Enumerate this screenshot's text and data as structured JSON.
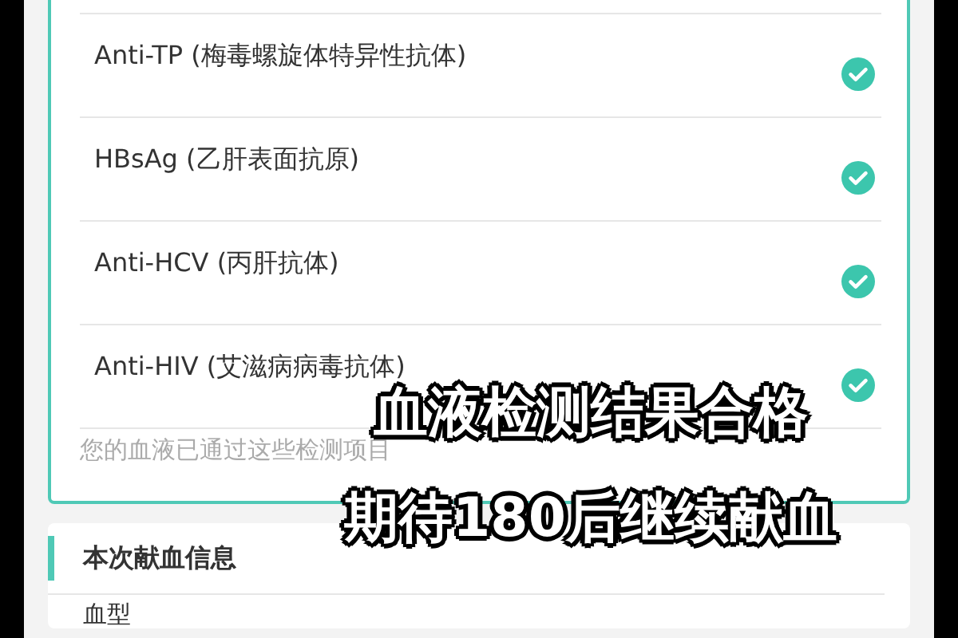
{
  "tests": [
    {
      "label": "Anti-TP (梅毒螺旋体特异性抗体)",
      "passed": true
    },
    {
      "label": "HBsAg (乙肝表面抗原)",
      "passed": true
    },
    {
      "label": "Anti-HCV (丙肝抗体)",
      "passed": true
    },
    {
      "label": "Anti-HIV (艾滋病病毒抗体)",
      "passed": true
    }
  ],
  "tests_note": "您的血液已通过这些检测项目",
  "donation_info": {
    "title": "本次献血信息",
    "fields": [
      {
        "label": "血型"
      }
    ]
  },
  "caption": [
    "血液检测结果合格",
    "期待180后继续献血"
  ]
}
